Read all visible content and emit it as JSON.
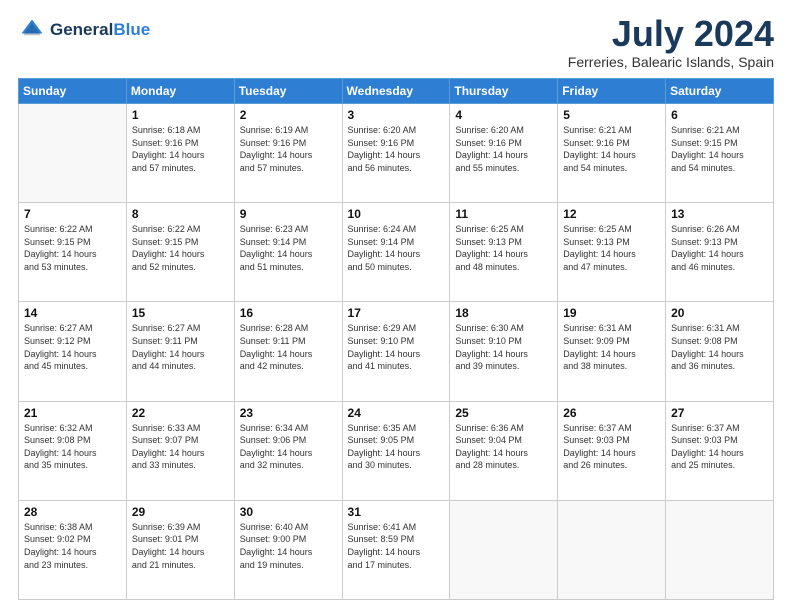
{
  "header": {
    "logo_line1": "General",
    "logo_line2": "Blue",
    "month_title": "July 2024",
    "location": "Ferreries, Balearic Islands, Spain"
  },
  "weekdays": [
    "Sunday",
    "Monday",
    "Tuesday",
    "Wednesday",
    "Thursday",
    "Friday",
    "Saturday"
  ],
  "weeks": [
    [
      {
        "day": "",
        "empty": true
      },
      {
        "day": "1",
        "sunrise": "6:18 AM",
        "sunset": "9:16 PM",
        "daylight": "14 hours and 57 minutes."
      },
      {
        "day": "2",
        "sunrise": "6:19 AM",
        "sunset": "9:16 PM",
        "daylight": "14 hours and 57 minutes."
      },
      {
        "day": "3",
        "sunrise": "6:20 AM",
        "sunset": "9:16 PM",
        "daylight": "14 hours and 56 minutes."
      },
      {
        "day": "4",
        "sunrise": "6:20 AM",
        "sunset": "9:16 PM",
        "daylight": "14 hours and 55 minutes."
      },
      {
        "day": "5",
        "sunrise": "6:21 AM",
        "sunset": "9:16 PM",
        "daylight": "14 hours and 54 minutes."
      },
      {
        "day": "6",
        "sunrise": "6:21 AM",
        "sunset": "9:15 PM",
        "daylight": "14 hours and 54 minutes."
      }
    ],
    [
      {
        "day": "7",
        "sunrise": "6:22 AM",
        "sunset": "9:15 PM",
        "daylight": "14 hours and 53 minutes."
      },
      {
        "day": "8",
        "sunrise": "6:22 AM",
        "sunset": "9:15 PM",
        "daylight": "14 hours and 52 minutes."
      },
      {
        "day": "9",
        "sunrise": "6:23 AM",
        "sunset": "9:14 PM",
        "daylight": "14 hours and 51 minutes."
      },
      {
        "day": "10",
        "sunrise": "6:24 AM",
        "sunset": "9:14 PM",
        "daylight": "14 hours and 50 minutes."
      },
      {
        "day": "11",
        "sunrise": "6:25 AM",
        "sunset": "9:13 PM",
        "daylight": "14 hours and 48 minutes."
      },
      {
        "day": "12",
        "sunrise": "6:25 AM",
        "sunset": "9:13 PM",
        "daylight": "14 hours and 47 minutes."
      },
      {
        "day": "13",
        "sunrise": "6:26 AM",
        "sunset": "9:13 PM",
        "daylight": "14 hours and 46 minutes."
      }
    ],
    [
      {
        "day": "14",
        "sunrise": "6:27 AM",
        "sunset": "9:12 PM",
        "daylight": "14 hours and 45 minutes."
      },
      {
        "day": "15",
        "sunrise": "6:27 AM",
        "sunset": "9:11 PM",
        "daylight": "14 hours and 44 minutes."
      },
      {
        "day": "16",
        "sunrise": "6:28 AM",
        "sunset": "9:11 PM",
        "daylight": "14 hours and 42 minutes."
      },
      {
        "day": "17",
        "sunrise": "6:29 AM",
        "sunset": "9:10 PM",
        "daylight": "14 hours and 41 minutes."
      },
      {
        "day": "18",
        "sunrise": "6:30 AM",
        "sunset": "9:10 PM",
        "daylight": "14 hours and 39 minutes."
      },
      {
        "day": "19",
        "sunrise": "6:31 AM",
        "sunset": "9:09 PM",
        "daylight": "14 hours and 38 minutes."
      },
      {
        "day": "20",
        "sunrise": "6:31 AM",
        "sunset": "9:08 PM",
        "daylight": "14 hours and 36 minutes."
      }
    ],
    [
      {
        "day": "21",
        "sunrise": "6:32 AM",
        "sunset": "9:08 PM",
        "daylight": "14 hours and 35 minutes."
      },
      {
        "day": "22",
        "sunrise": "6:33 AM",
        "sunset": "9:07 PM",
        "daylight": "14 hours and 33 minutes."
      },
      {
        "day": "23",
        "sunrise": "6:34 AM",
        "sunset": "9:06 PM",
        "daylight": "14 hours and 32 minutes."
      },
      {
        "day": "24",
        "sunrise": "6:35 AM",
        "sunset": "9:05 PM",
        "daylight": "14 hours and 30 minutes."
      },
      {
        "day": "25",
        "sunrise": "6:36 AM",
        "sunset": "9:04 PM",
        "daylight": "14 hours and 28 minutes."
      },
      {
        "day": "26",
        "sunrise": "6:37 AM",
        "sunset": "9:03 PM",
        "daylight": "14 hours and 26 minutes."
      },
      {
        "day": "27",
        "sunrise": "6:37 AM",
        "sunset": "9:03 PM",
        "daylight": "14 hours and 25 minutes."
      }
    ],
    [
      {
        "day": "28",
        "sunrise": "6:38 AM",
        "sunset": "9:02 PM",
        "daylight": "14 hours and 23 minutes."
      },
      {
        "day": "29",
        "sunrise": "6:39 AM",
        "sunset": "9:01 PM",
        "daylight": "14 hours and 21 minutes."
      },
      {
        "day": "30",
        "sunrise": "6:40 AM",
        "sunset": "9:00 PM",
        "daylight": "14 hours and 19 minutes."
      },
      {
        "day": "31",
        "sunrise": "6:41 AM",
        "sunset": "8:59 PM",
        "daylight": "14 hours and 17 minutes."
      },
      {
        "day": "",
        "empty": true
      },
      {
        "day": "",
        "empty": true
      },
      {
        "day": "",
        "empty": true
      }
    ]
  ],
  "labels": {
    "sunrise": "Sunrise:",
    "sunset": "Sunset:",
    "daylight": "Daylight:"
  }
}
